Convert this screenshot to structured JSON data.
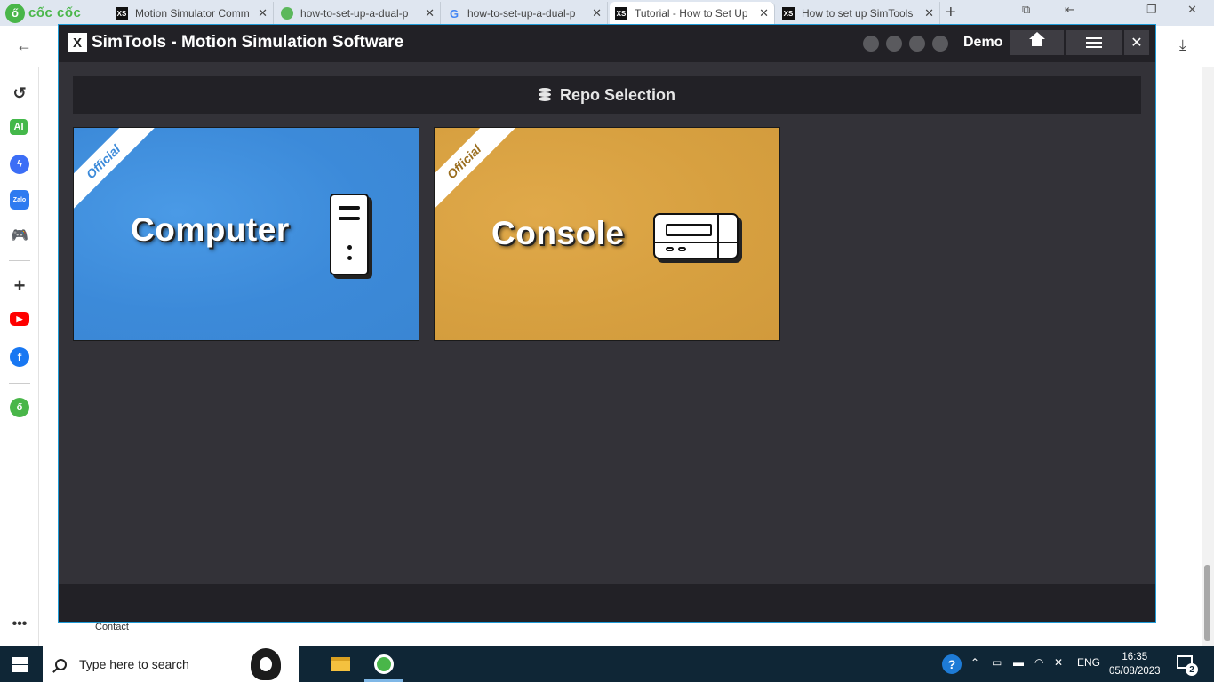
{
  "browser": {
    "brand": "cốc cốc",
    "tabs": [
      {
        "title": "Motion Simulator Comm",
        "favicon": "XS"
      },
      {
        "title": "how-to-set-up-a-dual-p",
        "favicon": "leaf"
      },
      {
        "title": "how-to-set-up-a-dual-p",
        "favicon": "G"
      },
      {
        "title": "Tutorial - How to Set Up",
        "favicon": "XS"
      },
      {
        "title": "How to set up SimTools",
        "favicon": "XS"
      }
    ],
    "new_tab": "+",
    "sidebar_items": [
      "history",
      "AI",
      "messenger",
      "Zalo",
      "games",
      "add",
      "youtube",
      "facebook",
      "coccoc-extension",
      "more"
    ]
  },
  "app": {
    "title": "SimTools - Motion Simulation Software",
    "logo_text": "X",
    "user_label": "Demo",
    "section_title": "Repo Selection",
    "cards": [
      {
        "label": "Computer",
        "ribbon": "Official",
        "color": "#3c8ad9"
      },
      {
        "label": "Console",
        "ribbon": "Official",
        "color": "#d7a040"
      }
    ],
    "close_glyph": "✕"
  },
  "page": {
    "contact_link": "Contact"
  },
  "taskbar": {
    "search_placeholder": "Type here to search",
    "language": "ENG",
    "time": "16:35",
    "date": "05/08/2023",
    "notification_count": "2"
  }
}
